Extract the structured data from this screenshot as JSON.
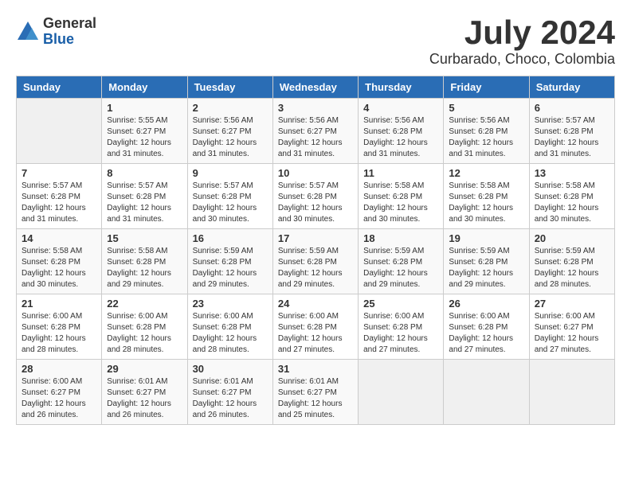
{
  "logo": {
    "general": "General",
    "blue": "Blue"
  },
  "title": {
    "month_year": "July 2024",
    "location": "Curbarado, Choco, Colombia"
  },
  "headers": [
    "Sunday",
    "Monday",
    "Tuesday",
    "Wednesday",
    "Thursday",
    "Friday",
    "Saturday"
  ],
  "weeks": [
    [
      {
        "day": "",
        "info": ""
      },
      {
        "day": "1",
        "info": "Sunrise: 5:55 AM\nSunset: 6:27 PM\nDaylight: 12 hours\nand 31 minutes."
      },
      {
        "day": "2",
        "info": "Sunrise: 5:56 AM\nSunset: 6:27 PM\nDaylight: 12 hours\nand 31 minutes."
      },
      {
        "day": "3",
        "info": "Sunrise: 5:56 AM\nSunset: 6:27 PM\nDaylight: 12 hours\nand 31 minutes."
      },
      {
        "day": "4",
        "info": "Sunrise: 5:56 AM\nSunset: 6:28 PM\nDaylight: 12 hours\nand 31 minutes."
      },
      {
        "day": "5",
        "info": "Sunrise: 5:56 AM\nSunset: 6:28 PM\nDaylight: 12 hours\nand 31 minutes."
      },
      {
        "day": "6",
        "info": "Sunrise: 5:57 AM\nSunset: 6:28 PM\nDaylight: 12 hours\nand 31 minutes."
      }
    ],
    [
      {
        "day": "7",
        "info": "Sunrise: 5:57 AM\nSunset: 6:28 PM\nDaylight: 12 hours\nand 31 minutes."
      },
      {
        "day": "8",
        "info": "Sunrise: 5:57 AM\nSunset: 6:28 PM\nDaylight: 12 hours\nand 31 minutes."
      },
      {
        "day": "9",
        "info": "Sunrise: 5:57 AM\nSunset: 6:28 PM\nDaylight: 12 hours\nand 30 minutes."
      },
      {
        "day": "10",
        "info": "Sunrise: 5:57 AM\nSunset: 6:28 PM\nDaylight: 12 hours\nand 30 minutes."
      },
      {
        "day": "11",
        "info": "Sunrise: 5:58 AM\nSunset: 6:28 PM\nDaylight: 12 hours\nand 30 minutes."
      },
      {
        "day": "12",
        "info": "Sunrise: 5:58 AM\nSunset: 6:28 PM\nDaylight: 12 hours\nand 30 minutes."
      },
      {
        "day": "13",
        "info": "Sunrise: 5:58 AM\nSunset: 6:28 PM\nDaylight: 12 hours\nand 30 minutes."
      }
    ],
    [
      {
        "day": "14",
        "info": "Sunrise: 5:58 AM\nSunset: 6:28 PM\nDaylight: 12 hours\nand 30 minutes."
      },
      {
        "day": "15",
        "info": "Sunrise: 5:58 AM\nSunset: 6:28 PM\nDaylight: 12 hours\nand 29 minutes."
      },
      {
        "day": "16",
        "info": "Sunrise: 5:59 AM\nSunset: 6:28 PM\nDaylight: 12 hours\nand 29 minutes."
      },
      {
        "day": "17",
        "info": "Sunrise: 5:59 AM\nSunset: 6:28 PM\nDaylight: 12 hours\nand 29 minutes."
      },
      {
        "day": "18",
        "info": "Sunrise: 5:59 AM\nSunset: 6:28 PM\nDaylight: 12 hours\nand 29 minutes."
      },
      {
        "day": "19",
        "info": "Sunrise: 5:59 AM\nSunset: 6:28 PM\nDaylight: 12 hours\nand 29 minutes."
      },
      {
        "day": "20",
        "info": "Sunrise: 5:59 AM\nSunset: 6:28 PM\nDaylight: 12 hours\nand 28 minutes."
      }
    ],
    [
      {
        "day": "21",
        "info": "Sunrise: 6:00 AM\nSunset: 6:28 PM\nDaylight: 12 hours\nand 28 minutes."
      },
      {
        "day": "22",
        "info": "Sunrise: 6:00 AM\nSunset: 6:28 PM\nDaylight: 12 hours\nand 28 minutes."
      },
      {
        "day": "23",
        "info": "Sunrise: 6:00 AM\nSunset: 6:28 PM\nDaylight: 12 hours\nand 28 minutes."
      },
      {
        "day": "24",
        "info": "Sunrise: 6:00 AM\nSunset: 6:28 PM\nDaylight: 12 hours\nand 27 minutes."
      },
      {
        "day": "25",
        "info": "Sunrise: 6:00 AM\nSunset: 6:28 PM\nDaylight: 12 hours\nand 27 minutes."
      },
      {
        "day": "26",
        "info": "Sunrise: 6:00 AM\nSunset: 6:28 PM\nDaylight: 12 hours\nand 27 minutes."
      },
      {
        "day": "27",
        "info": "Sunrise: 6:00 AM\nSunset: 6:27 PM\nDaylight: 12 hours\nand 27 minutes."
      }
    ],
    [
      {
        "day": "28",
        "info": "Sunrise: 6:00 AM\nSunset: 6:27 PM\nDaylight: 12 hours\nand 26 minutes."
      },
      {
        "day": "29",
        "info": "Sunrise: 6:01 AM\nSunset: 6:27 PM\nDaylight: 12 hours\nand 26 minutes."
      },
      {
        "day": "30",
        "info": "Sunrise: 6:01 AM\nSunset: 6:27 PM\nDaylight: 12 hours\nand 26 minutes."
      },
      {
        "day": "31",
        "info": "Sunrise: 6:01 AM\nSunset: 6:27 PM\nDaylight: 12 hours\nand 25 minutes."
      },
      {
        "day": "",
        "info": ""
      },
      {
        "day": "",
        "info": ""
      },
      {
        "day": "",
        "info": ""
      }
    ]
  ]
}
